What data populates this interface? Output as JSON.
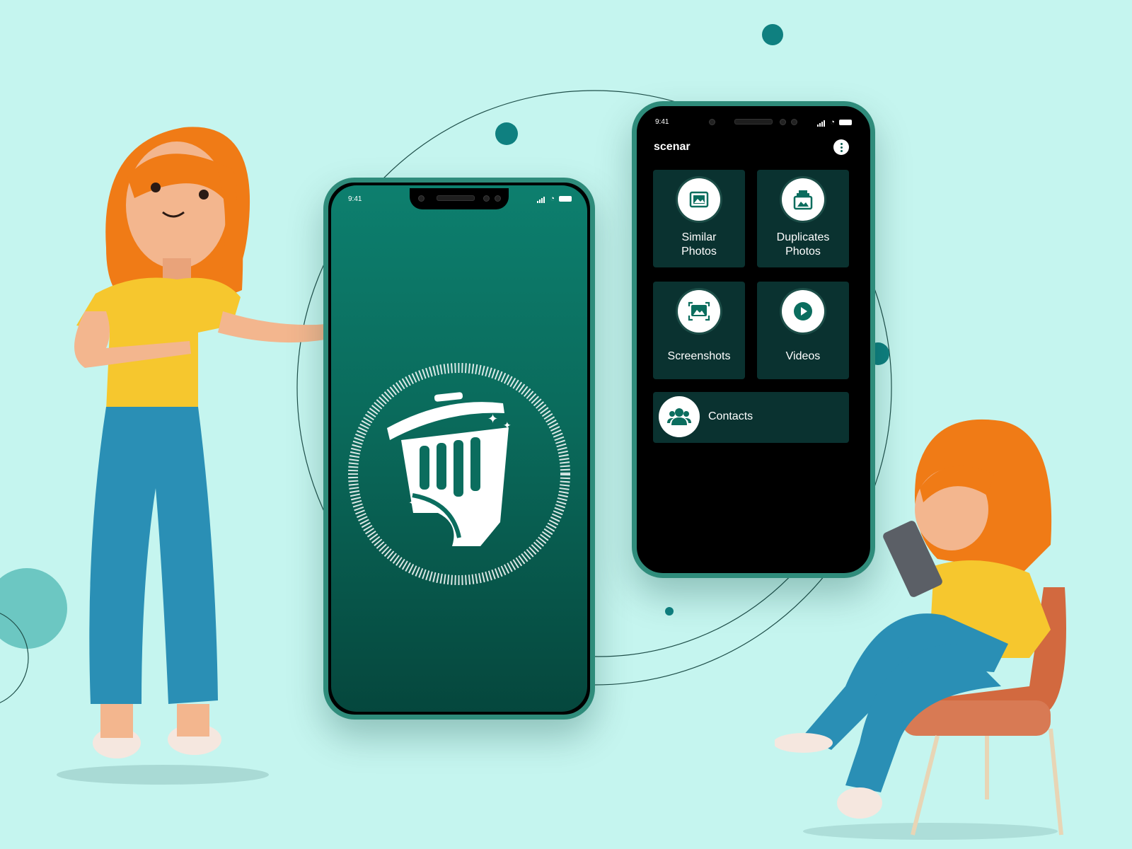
{
  "colors": {
    "background": "#c5f5ef",
    "accent_teal": "#0b7c6c",
    "tile_bg": "#0a3230",
    "phone_frame": "#2f8c7b"
  },
  "splash_phone": {
    "status_time": "9:41",
    "logo_icon": "trash-bin-cleaner-icon"
  },
  "app_phone": {
    "status_time": "9:41",
    "app_title": "scenar",
    "menu_icon": "more-vertical-icon",
    "tiles": [
      {
        "label": "Similar\nPhotos",
        "icon": "image-icon"
      },
      {
        "label": "Duplicates\nPhotos",
        "icon": "image-stack-icon"
      },
      {
        "label": "Screenshots",
        "icon": "screenshot-icon"
      },
      {
        "label": "Videos",
        "icon": "play-icon"
      }
    ],
    "contacts": {
      "label": "Contacts",
      "icon": "users-icon"
    }
  }
}
